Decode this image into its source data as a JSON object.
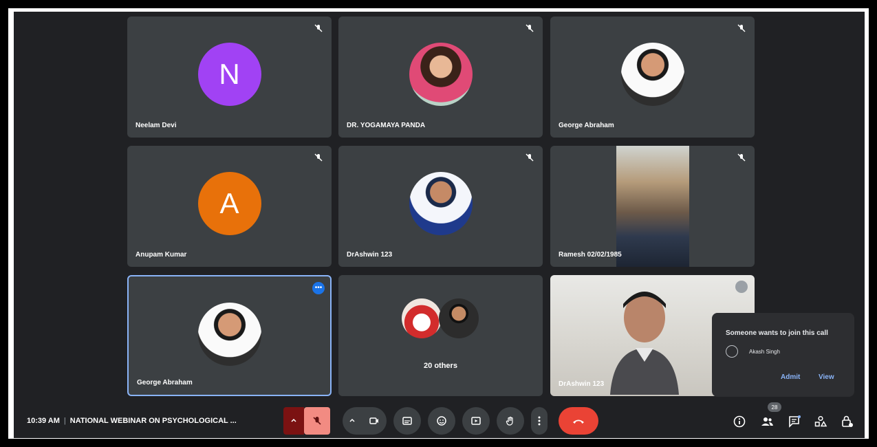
{
  "tiles": [
    {
      "name": "Neelam Devi",
      "avatar_letter": "N"
    },
    {
      "name": "DR. YOGAMAYA PANDA"
    },
    {
      "name": "George Abraham"
    },
    {
      "name": "Anupam Kumar",
      "avatar_letter": "A"
    },
    {
      "name": "DrAshwin 123"
    },
    {
      "name": "Ramesh 02/02/1985"
    },
    {
      "name": "George Abraham"
    },
    {
      "name": "20 others"
    },
    {
      "name": "DrAshwin 123"
    }
  ],
  "join_request": {
    "title": "Someone wants to join this call",
    "person": "Akash Singh",
    "admit_label": "Admit",
    "view_label": "View"
  },
  "meeting": {
    "time": "10:39 AM",
    "separator": "|",
    "title": "NATIONAL WEBINAR ON PSYCHOLOGICAL ..."
  },
  "participants_badge": "28",
  "icons": {
    "mute": "mic-off-icon",
    "camera": "videocam-icon",
    "captions": "closed-caption-icon",
    "emoji": "emoji-icon",
    "present": "present-icon",
    "hand": "raise-hand-icon",
    "more": "more-vert-icon",
    "hangup": "call-end-icon",
    "info": "info-icon",
    "people": "people-icon",
    "chat": "chat-icon",
    "activities": "activities-icon",
    "host": "host-controls-icon"
  },
  "colors": {
    "background": "#202124",
    "tile": "#3c4043",
    "accent": "#8ab4f8",
    "hangup": "#ea4335"
  }
}
